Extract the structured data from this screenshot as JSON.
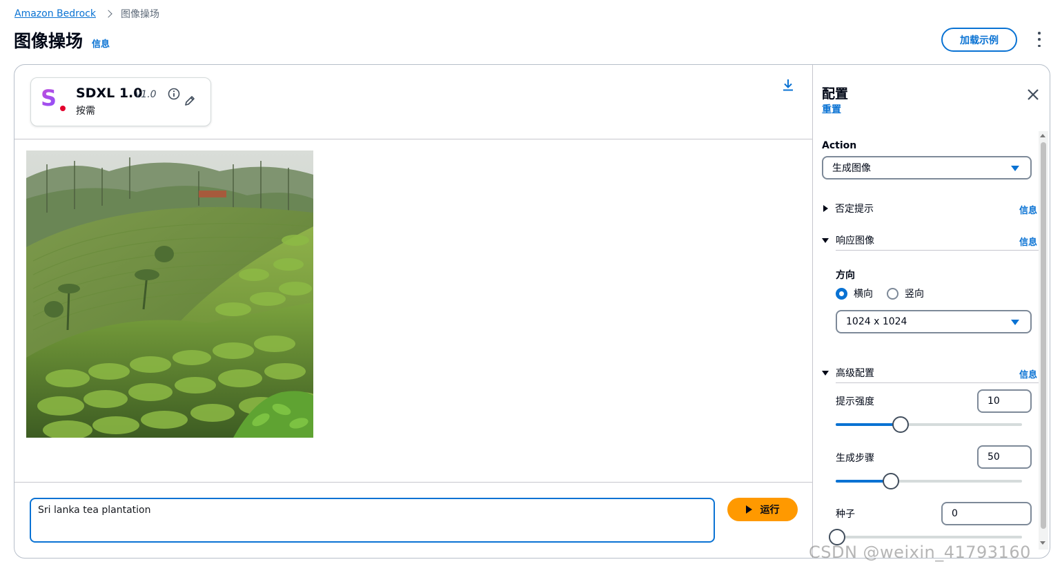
{
  "breadcrumb": {
    "root": "Amazon Bedrock",
    "current": "图像操场"
  },
  "header": {
    "title": "图像操场",
    "info": "信息",
    "load_examples": "加载示例"
  },
  "model": {
    "name": "SDXL 1.0",
    "version": "v1.0",
    "pricing": "按需"
  },
  "prompt": {
    "text": "Sri lanka tea plantation",
    "run_label": "运行"
  },
  "config": {
    "title": "配置",
    "reset": "重置",
    "action_label": "Action",
    "action_value": "生成图像",
    "negative_prompt": "否定提示",
    "response_image": "响应图像",
    "info": "信息",
    "orientation_label": "方向",
    "orientation_options": [
      "横向",
      "竖向"
    ],
    "orientation_selected": "横向",
    "size_value": "1024 x 1024",
    "advanced": "高级配置",
    "prompt_strength_label": "提示强度",
    "prompt_strength_value": "10",
    "prompt_strength_level": 0.34,
    "steps_label": "生成步骤",
    "steps_value": "50",
    "steps_level": 0.29,
    "seed_label": "种子",
    "seed_value": "0",
    "seed_level": 0.0
  },
  "watermark": "CSDN @weixin_41793160",
  "colors": {
    "accent": "#0972d3",
    "run_button": "#ff9900",
    "text": "#000716"
  }
}
